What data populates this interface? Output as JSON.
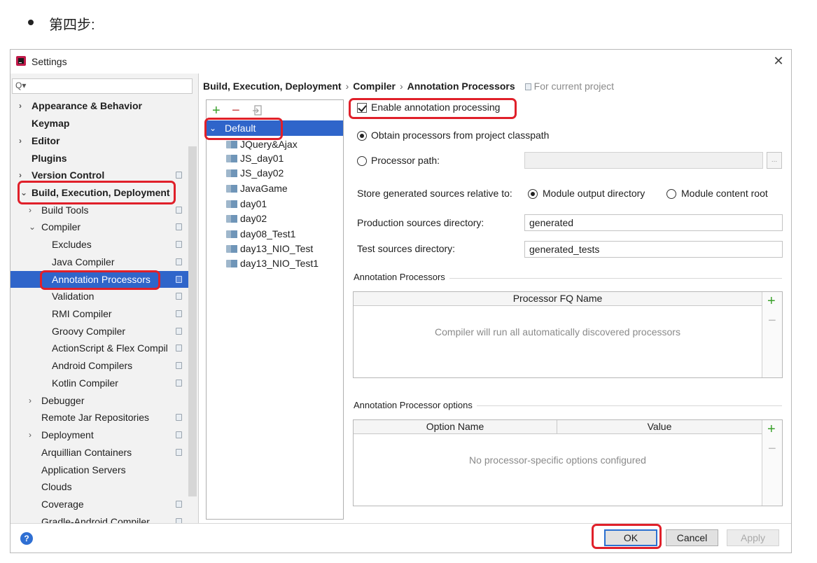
{
  "doc": {
    "heading": "第四步:"
  },
  "window": {
    "title": "Settings",
    "close_glyph": "✕"
  },
  "search": {
    "icon_glyph": "Q▾",
    "placeholder": ""
  },
  "sidebar": {
    "items": [
      {
        "label": "Appearance & Behavior"
      },
      {
        "label": "Keymap"
      },
      {
        "label": "Editor"
      },
      {
        "label": "Plugins"
      },
      {
        "label": "Version Control"
      },
      {
        "label": "Build, Execution, Deployment"
      },
      {
        "label": "Build Tools"
      },
      {
        "label": "Compiler"
      },
      {
        "label": "Excludes"
      },
      {
        "label": "Java Compiler"
      },
      {
        "label": "Annotation Processors"
      },
      {
        "label": "Validation"
      },
      {
        "label": "RMI Compiler"
      },
      {
        "label": "Groovy Compiler"
      },
      {
        "label": "ActionScript & Flex Compil"
      },
      {
        "label": "Android Compilers"
      },
      {
        "label": "Kotlin Compiler"
      },
      {
        "label": "Debugger"
      },
      {
        "label": "Remote Jar Repositories"
      },
      {
        "label": "Deployment"
      },
      {
        "label": "Arquillian Containers"
      },
      {
        "label": "Application Servers"
      },
      {
        "label": "Clouds"
      },
      {
        "label": "Coverage"
      },
      {
        "label": "Gradle-Android Compiler"
      }
    ]
  },
  "breadcrumb": {
    "parts": [
      "Build, Execution, Deployment",
      "Compiler",
      "Annotation Processors"
    ],
    "separator": "›",
    "scope": "For current project"
  },
  "profiles": {
    "default_label": "Default",
    "modules": [
      "JQuery&Ajax",
      "JS_day01",
      "JS_day02",
      "JavaGame",
      "day01",
      "day02",
      "day08_Test1",
      "day13_NIO_Test",
      "day13_NIO_Test1"
    ]
  },
  "settings": {
    "enable_label": "Enable annotation processing",
    "enabled": true,
    "obtain_label": "Obtain processors from project classpath",
    "processor_path_label": "Processor path:",
    "processor_path_value": "",
    "store_label": "Store generated sources relative to:",
    "module_output_label": "Module output directory",
    "module_content_label": "Module content root",
    "production_label": "Production sources directory:",
    "production_value": "generated",
    "test_label": "Test sources directory:",
    "test_value": "generated_tests",
    "dots": "..."
  },
  "annotation_processors": {
    "group_title": "Annotation Processors",
    "column": "Processor FQ Name",
    "empty": "Compiler will run all automatically discovered processors"
  },
  "processor_options": {
    "group_title": "Annotation Processor options",
    "columns": [
      "Option Name",
      "Value"
    ],
    "empty": "No processor-specific options configured"
  },
  "buttons": {
    "ok": "OK",
    "cancel": "Cancel",
    "apply": "Apply",
    "help": "?"
  },
  "glyphs": {
    "plus": "+",
    "minus": "−",
    "expand": "›",
    "collapse": "⌄"
  },
  "colors": {
    "selection": "#2f65ca",
    "highlight": "#e0202a",
    "add": "#3aa02b"
  }
}
